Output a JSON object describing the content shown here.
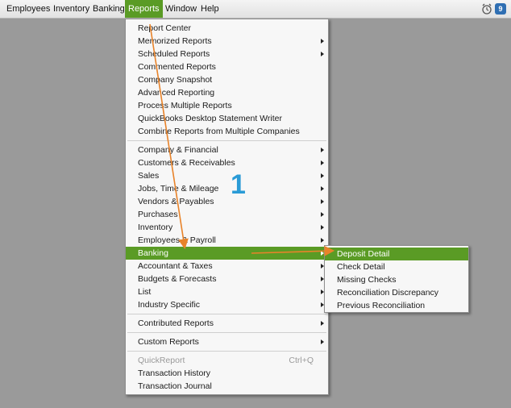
{
  "menubar": {
    "items": [
      "Employees",
      "Inventory",
      "Banking",
      "Reports",
      "Window",
      "Help"
    ],
    "active": "Reports",
    "badge": "9",
    "alarm_icon": "alarm-clock-icon"
  },
  "reports_menu": {
    "group1": [
      {
        "label": "Report Center"
      },
      {
        "label": "Memorized Reports",
        "submenu": true
      },
      {
        "label": "Scheduled Reports",
        "submenu": true
      },
      {
        "label": "Commented Reports"
      },
      {
        "label": "Company Snapshot"
      },
      {
        "label": "Advanced Reporting"
      },
      {
        "label": "Process Multiple Reports"
      },
      {
        "label": "QuickBooks Desktop Statement Writer"
      },
      {
        "label": "Combine Reports from Multiple Companies"
      }
    ],
    "group2": [
      {
        "label": "Company & Financial",
        "submenu": true
      },
      {
        "label": "Customers & Receivables",
        "submenu": true
      },
      {
        "label": "Sales",
        "submenu": true
      },
      {
        "label": "Jobs, Time & Mileage",
        "submenu": true
      },
      {
        "label": "Vendors & Payables",
        "submenu": true
      },
      {
        "label": "Purchases",
        "submenu": true
      },
      {
        "label": "Inventory",
        "submenu": true
      },
      {
        "label": "Employees & Payroll",
        "submenu": true
      },
      {
        "label": "Banking",
        "submenu": true,
        "highlighted": true
      },
      {
        "label": "Accountant & Taxes",
        "submenu": true
      },
      {
        "label": "Budgets & Forecasts",
        "submenu": true
      },
      {
        "label": "List",
        "submenu": true
      },
      {
        "label": "Industry Specific",
        "submenu": true
      }
    ],
    "group3": [
      {
        "label": "Contributed Reports",
        "submenu": true
      }
    ],
    "group4": [
      {
        "label": "Custom Reports",
        "submenu": true
      }
    ],
    "group5": [
      {
        "label": "QuickReport",
        "shortcut": "Ctrl+Q",
        "disabled": true
      },
      {
        "label": "Transaction History"
      },
      {
        "label": "Transaction Journal"
      }
    ]
  },
  "banking_submenu": [
    {
      "label": "Deposit Detail",
      "highlighted": true
    },
    {
      "label": "Check Detail"
    },
    {
      "label": "Missing Checks"
    },
    {
      "label": "Reconciliation Discrepancy"
    },
    {
      "label": "Previous Reconciliation"
    }
  ],
  "annotation": {
    "step_number": "1",
    "arrow_color": "#e8832a",
    "number_color": "#2a9bd6"
  },
  "colors": {
    "highlight": "#5a9b25",
    "desktop": "#9a9a9a"
  }
}
